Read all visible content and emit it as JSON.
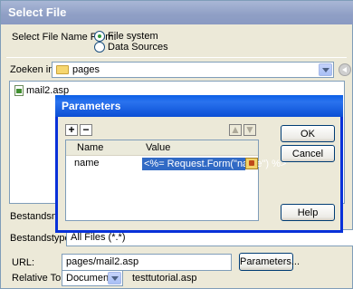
{
  "window": {
    "title": "Select File"
  },
  "select_from": {
    "label": "Select File Name From:",
    "options": [
      {
        "label": "File system",
        "selected": true
      },
      {
        "label": "Data Sources",
        "selected": false
      }
    ]
  },
  "look_in": {
    "label": "Zoeken in:",
    "value": "pages"
  },
  "files": [
    {
      "name": "mail2.asp"
    }
  ],
  "filename_label": "Bestandsnaam",
  "filetype": {
    "label": "Bestandstypen:",
    "value": "All Files (*.*)"
  },
  "url": {
    "label": "URL:",
    "value": "pages/mail2.asp",
    "button": "Parameters..."
  },
  "relative": {
    "label": "Relative To:",
    "value": "Document",
    "file": "testtutorial.asp"
  },
  "parameters_dialog": {
    "title": "Parameters",
    "add_label": "+",
    "remove_label": "−",
    "columns": [
      "Name",
      "Value"
    ],
    "rows": [
      {
        "name": "name",
        "value": "<%= Request.Form(\"name\") %>"
      }
    ],
    "buttons": {
      "ok": "OK",
      "cancel": "Cancel",
      "help": "Help"
    }
  }
}
